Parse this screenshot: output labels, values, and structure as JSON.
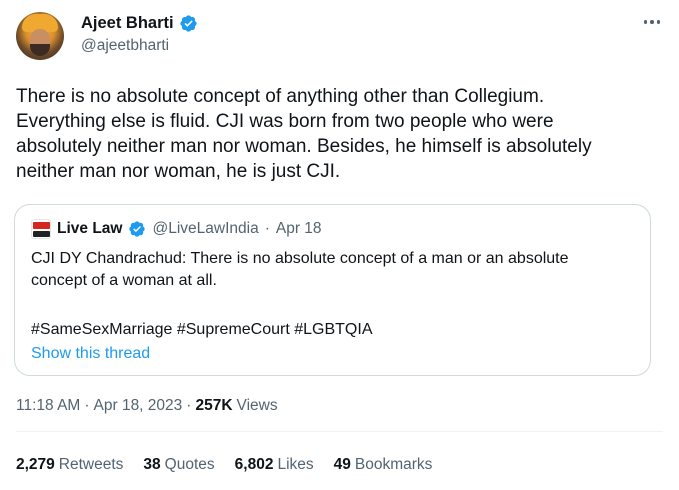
{
  "author": {
    "display_name": "Ajeet Bharti",
    "handle": "@ajeetbharti",
    "verified": true
  },
  "tweet": {
    "text": "There is no absolute concept of anything other than Collegium.\nEverything else is fluid. CJI was born from two people who were\nabsolutely neither man nor woman. Besides, he himself is absolutely\nneither man nor woman, he is just CJI."
  },
  "quote": {
    "display_name": "Live Law",
    "handle": "@LiveLawIndia",
    "separator": "·",
    "date": "Apr 18",
    "text": "CJI DY Chandrachud: There is no absolute concept of a man or an absolute\nconcept of a woman at all.",
    "hashtags": "#SameSexMarriage #SupremeCourt #LGBTQIA",
    "show_thread": "Show this thread"
  },
  "meta": {
    "time": "11:18 AM",
    "separator1": "·",
    "date": "Apr 18, 2023",
    "separator2": "·",
    "views_count": "257K",
    "views_label": "Views"
  },
  "stats": {
    "retweets_count": "2,279",
    "retweets_label": "Retweets",
    "quotes_count": "38",
    "quotes_label": "Quotes",
    "likes_count": "6,802",
    "likes_label": "Likes",
    "bookmarks_count": "49",
    "bookmarks_label": "Bookmarks"
  },
  "colors": {
    "accent": "#1d9bf0",
    "secondary_text": "#536471",
    "primary_text": "#0f1419",
    "border": "#cfd9de"
  }
}
